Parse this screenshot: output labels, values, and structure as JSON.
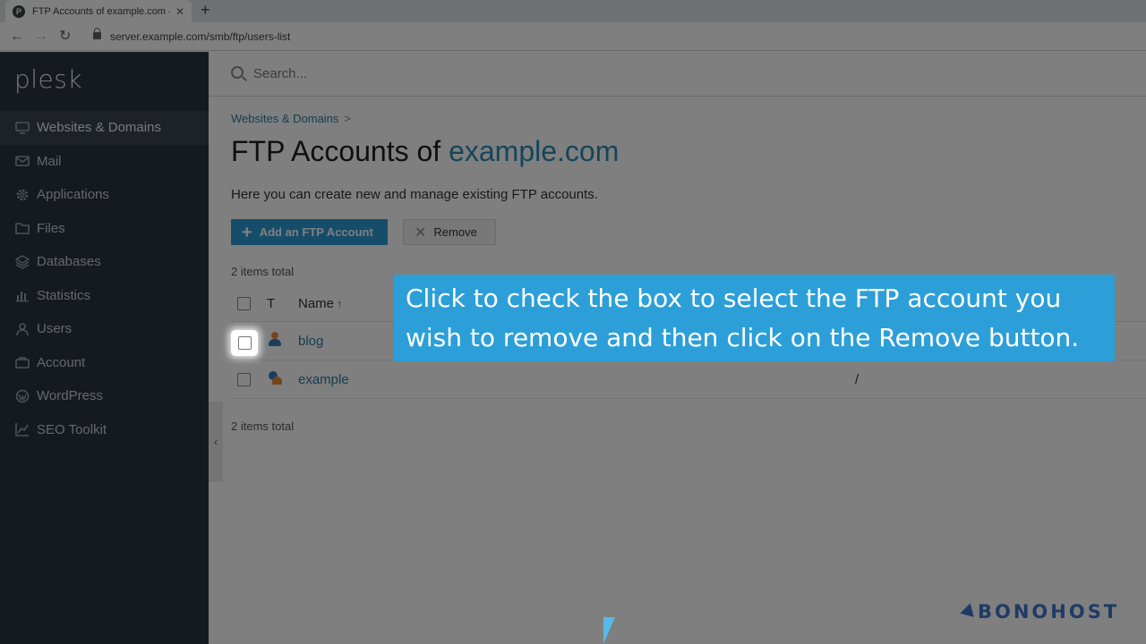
{
  "browser": {
    "tab_title": "FTP Accounts of example.com - Plesk",
    "favicon_letter": "P",
    "url": "server.example.com/smb/ftp/users-list"
  },
  "sidebar": {
    "logo": "plesk",
    "items": [
      {
        "label": "Websites & Domains",
        "icon": "monitor-icon",
        "active": true
      },
      {
        "label": "Mail",
        "icon": "envelope-icon"
      },
      {
        "label": "Applications",
        "icon": "gear-icon"
      },
      {
        "label": "Files",
        "icon": "folder-icon"
      },
      {
        "label": "Databases",
        "icon": "database-icon"
      },
      {
        "label": "Statistics",
        "icon": "bar-chart-icon"
      },
      {
        "label": "Users",
        "icon": "user-icon"
      },
      {
        "label": "Account",
        "icon": "briefcase-icon"
      },
      {
        "label": "WordPress",
        "icon": "wordpress-icon"
      },
      {
        "label": "SEO Toolkit",
        "icon": "trend-chart-icon"
      }
    ]
  },
  "search": {
    "placeholder": "Search..."
  },
  "breadcrumb": {
    "item": "Websites & Domains",
    "separator": ">"
  },
  "page": {
    "title_prefix": "FTP Accounts of ",
    "title_domain": "example.com",
    "description": "Here you can create new and manage existing FTP accounts."
  },
  "toolbar": {
    "add_label": "Add an FTP Account",
    "remove_label": "Remove"
  },
  "list": {
    "total_top": "2 items total",
    "total_bottom": "2 items total",
    "columns": {
      "type": "T",
      "name": "Name",
      "sort_indicator": "↑"
    },
    "rows": [
      {
        "name": "blog",
        "path": "",
        "icon": "ftp-user-icon"
      },
      {
        "name": "example",
        "path": "/",
        "icon": "ftp-domain-user-icon"
      }
    ]
  },
  "callout": {
    "text": "Click to check the box to select the FTP account you wish to remove and then click on the Remove button."
  },
  "watermark": {
    "text": "BONOHOST"
  },
  "colors": {
    "sidebar_bg": "#2b3440",
    "accent": "#2d9ad4",
    "callout_bg": "#2c9fd8",
    "link": "#2a7ea3"
  }
}
